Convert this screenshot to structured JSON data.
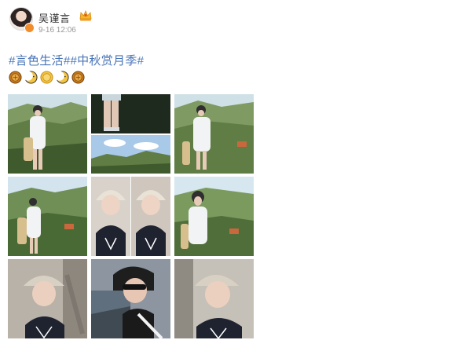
{
  "post": {
    "author": "吴谨言",
    "timestamp": "9-16 12:06",
    "text": "#言色生活##中秋赏月季#",
    "emojis": [
      "mooncake-icon",
      "crescent-moon-icon",
      "mooncake-icon",
      "crescent-moon-icon",
      "mooncake-icon"
    ]
  },
  "photos": [
    {
      "scene": "hill-standing-white-shirt"
    },
    {
      "scene": "legs-and-landscape"
    },
    {
      "scene": "hill-standing-white-shirt"
    },
    {
      "scene": "hill-standing-bag"
    },
    {
      "scene": "car-selfie-double"
    },
    {
      "scene": "hill-standing-cap"
    },
    {
      "scene": "car-bucket-hat"
    },
    {
      "scene": "car-sunglasses"
    },
    {
      "scene": "car-bucket-hat-close"
    }
  ],
  "colors": {
    "topic_link": "#4a76b8",
    "username": "#333333",
    "timestamp": "#999999",
    "vip_badge": "#f18d2c"
  }
}
